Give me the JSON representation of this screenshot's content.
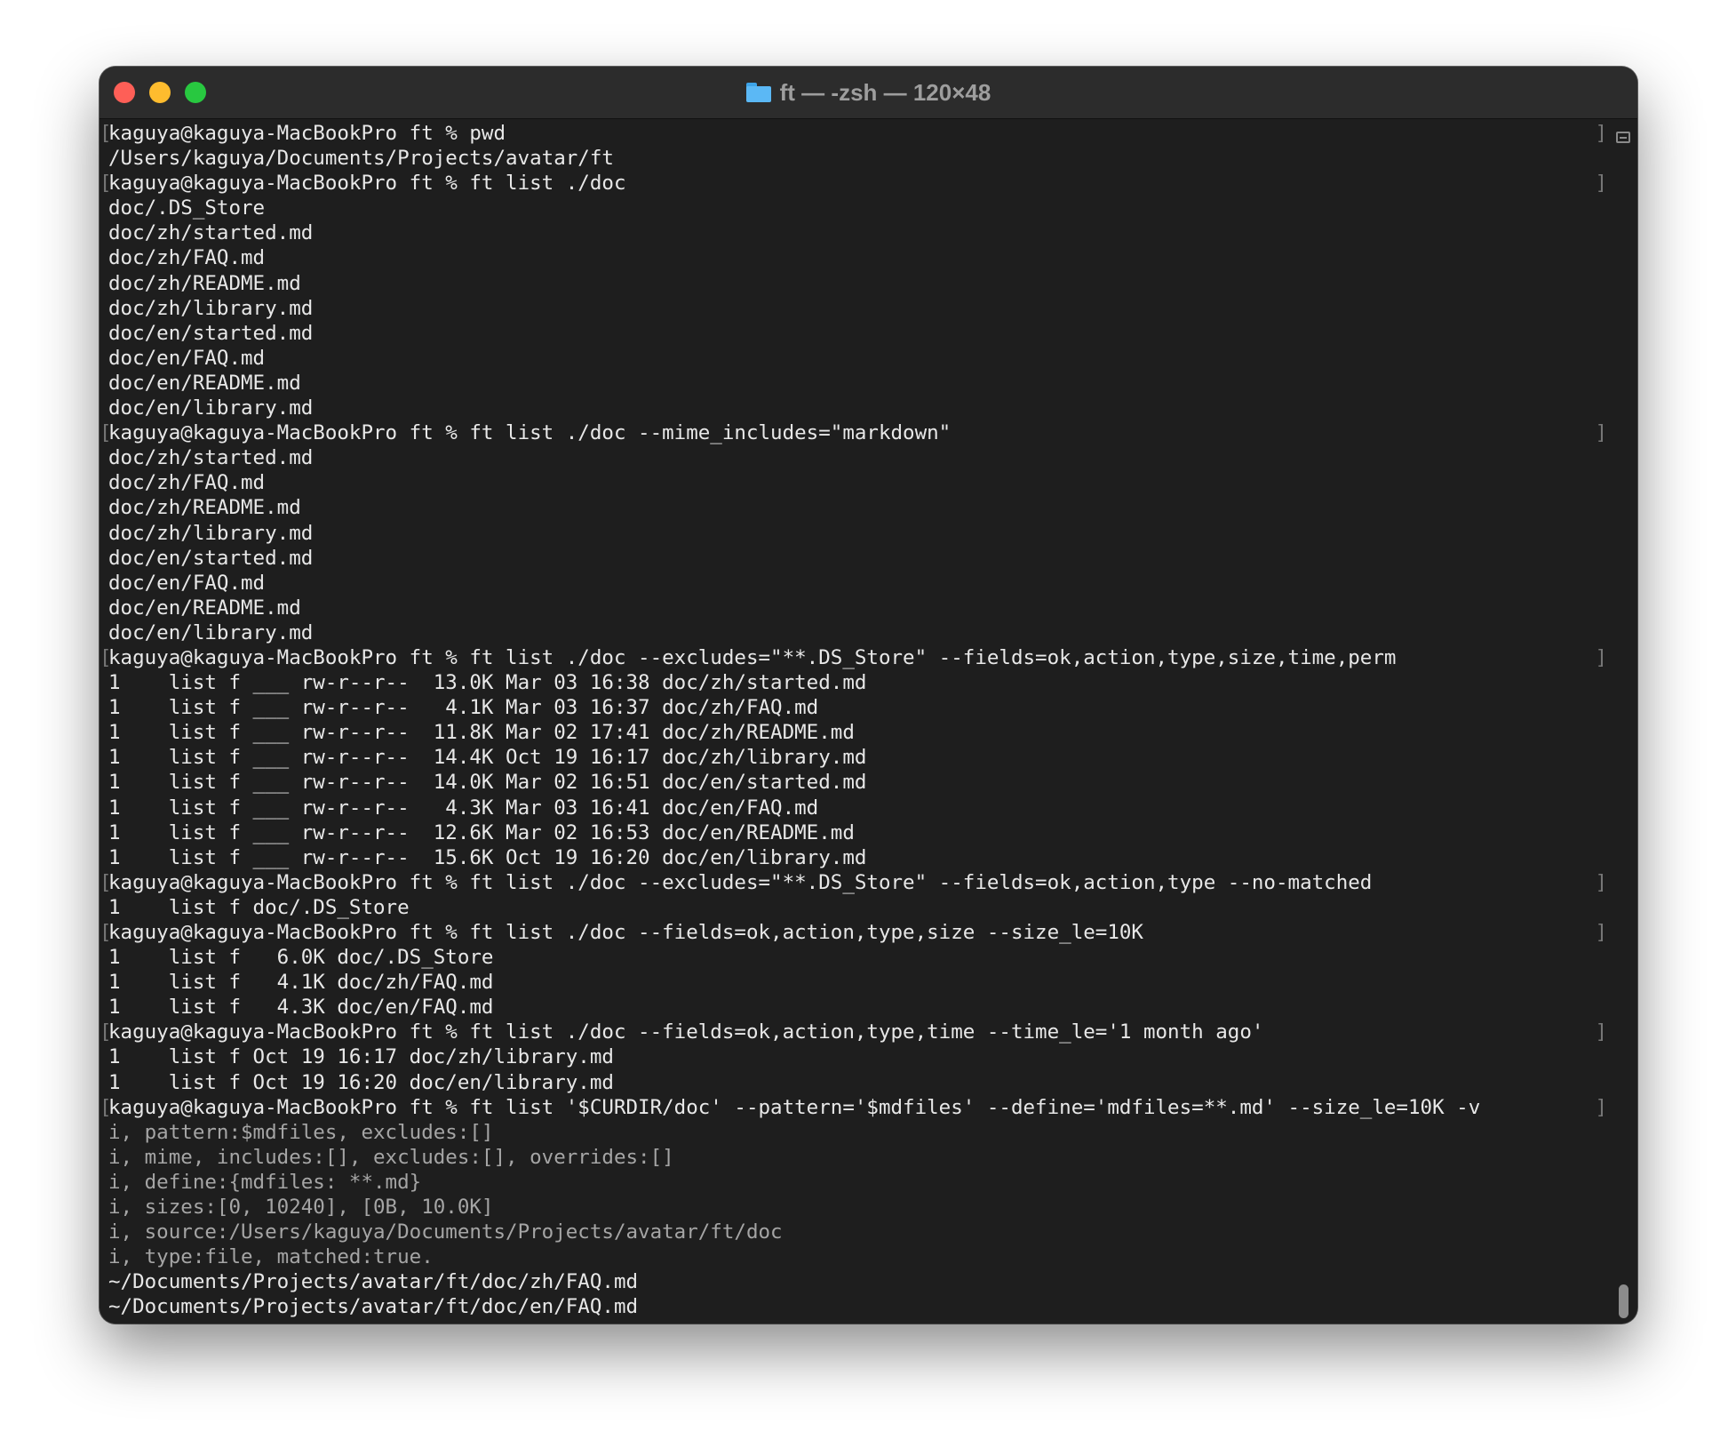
{
  "window": {
    "title": "ft — -zsh — 120×48",
    "folder_icon": "folder-icon"
  },
  "terminal": {
    "lines": [
      {
        "kind": "prompt",
        "text": "kaguya@kaguya-MacBookPro ft % pwd"
      },
      {
        "kind": "output",
        "text": "/Users/kaguya/Documents/Projects/avatar/ft"
      },
      {
        "kind": "prompt",
        "text": "kaguya@kaguya-MacBookPro ft % ft list ./doc"
      },
      {
        "kind": "output",
        "text": "doc/.DS_Store"
      },
      {
        "kind": "output",
        "text": "doc/zh/started.md"
      },
      {
        "kind": "output",
        "text": "doc/zh/FAQ.md"
      },
      {
        "kind": "output",
        "text": "doc/zh/README.md"
      },
      {
        "kind": "output",
        "text": "doc/zh/library.md"
      },
      {
        "kind": "output",
        "text": "doc/en/started.md"
      },
      {
        "kind": "output",
        "text": "doc/en/FAQ.md"
      },
      {
        "kind": "output",
        "text": "doc/en/README.md"
      },
      {
        "kind": "output",
        "text": "doc/en/library.md"
      },
      {
        "kind": "prompt",
        "text": "kaguya@kaguya-MacBookPro ft % ft list ./doc --mime_includes=\"markdown\""
      },
      {
        "kind": "output",
        "text": "doc/zh/started.md"
      },
      {
        "kind": "output",
        "text": "doc/zh/FAQ.md"
      },
      {
        "kind": "output",
        "text": "doc/zh/README.md"
      },
      {
        "kind": "output",
        "text": "doc/zh/library.md"
      },
      {
        "kind": "output",
        "text": "doc/en/started.md"
      },
      {
        "kind": "output",
        "text": "doc/en/FAQ.md"
      },
      {
        "kind": "output",
        "text": "doc/en/README.md"
      },
      {
        "kind": "output",
        "text": "doc/en/library.md"
      },
      {
        "kind": "prompt",
        "text": "kaguya@kaguya-MacBookPro ft % ft list ./doc --excludes=\"**.DS_Store\" --fields=ok,action,type,size,time,perm"
      },
      {
        "kind": "output",
        "text": "1    list f ___ rw-r--r--  13.0K Mar 03 16:38 doc/zh/started.md"
      },
      {
        "kind": "output",
        "text": "1    list f ___ rw-r--r--   4.1K Mar 03 16:37 doc/zh/FAQ.md"
      },
      {
        "kind": "output",
        "text": "1    list f ___ rw-r--r--  11.8K Mar 02 17:41 doc/zh/README.md"
      },
      {
        "kind": "output",
        "text": "1    list f ___ rw-r--r--  14.4K Oct 19 16:17 doc/zh/library.md"
      },
      {
        "kind": "output",
        "text": "1    list f ___ rw-r--r--  14.0K Mar 02 16:51 doc/en/started.md"
      },
      {
        "kind": "output",
        "text": "1    list f ___ rw-r--r--   4.3K Mar 03 16:41 doc/en/FAQ.md"
      },
      {
        "kind": "output",
        "text": "1    list f ___ rw-r--r--  12.6K Mar 02 16:53 doc/en/README.md"
      },
      {
        "kind": "output",
        "text": "1    list f ___ rw-r--r--  15.6K Oct 19 16:20 doc/en/library.md"
      },
      {
        "kind": "prompt",
        "text": "kaguya@kaguya-MacBookPro ft % ft list ./doc --excludes=\"**.DS_Store\" --fields=ok,action,type --no-matched"
      },
      {
        "kind": "output",
        "text": "1    list f doc/.DS_Store"
      },
      {
        "kind": "prompt",
        "text": "kaguya@kaguya-MacBookPro ft % ft list ./doc --fields=ok,action,type,size --size_le=10K"
      },
      {
        "kind": "output",
        "text": "1    list f   6.0K doc/.DS_Store"
      },
      {
        "kind": "output",
        "text": "1    list f   4.1K doc/zh/FAQ.md"
      },
      {
        "kind": "output",
        "text": "1    list f   4.3K doc/en/FAQ.md"
      },
      {
        "kind": "prompt",
        "text": "kaguya@kaguya-MacBookPro ft % ft list ./doc --fields=ok,action,type,time --time_le='1 month ago'"
      },
      {
        "kind": "output",
        "text": "1    list f Oct 19 16:17 doc/zh/library.md"
      },
      {
        "kind": "output",
        "text": "1    list f Oct 19 16:20 doc/en/library.md"
      },
      {
        "kind": "prompt",
        "text": "kaguya@kaguya-MacBookPro ft % ft list '$CURDIR/doc' --pattern='$mdfiles' --define='mdfiles=**.md' --size_le=10K -v"
      },
      {
        "kind": "info",
        "text": "i, pattern:$mdfiles, excludes:[]"
      },
      {
        "kind": "info",
        "text": "i, mime, includes:[], excludes:[], overrides:[]"
      },
      {
        "kind": "info",
        "text": "i, define:{mdfiles: **.md}"
      },
      {
        "kind": "info",
        "text": "i, sizes:[0, 10240], [0B, 10.0K]"
      },
      {
        "kind": "info",
        "text": "i, source:/Users/kaguya/Documents/Projects/avatar/ft/doc"
      },
      {
        "kind": "info",
        "text": "i, type:file, matched:true."
      },
      {
        "kind": "output",
        "text": "~/Documents/Projects/avatar/ft/doc/zh/FAQ.md"
      },
      {
        "kind": "output",
        "text": "~/Documents/Projects/avatar/ft/doc/en/FAQ.md"
      }
    ]
  },
  "colors": {
    "background": "#1e1e1e",
    "text": "#e8e8e8",
    "info_text": "#a5a5a5",
    "close": "#fe5f57",
    "minimize": "#febc2e",
    "zoom": "#28c840"
  }
}
